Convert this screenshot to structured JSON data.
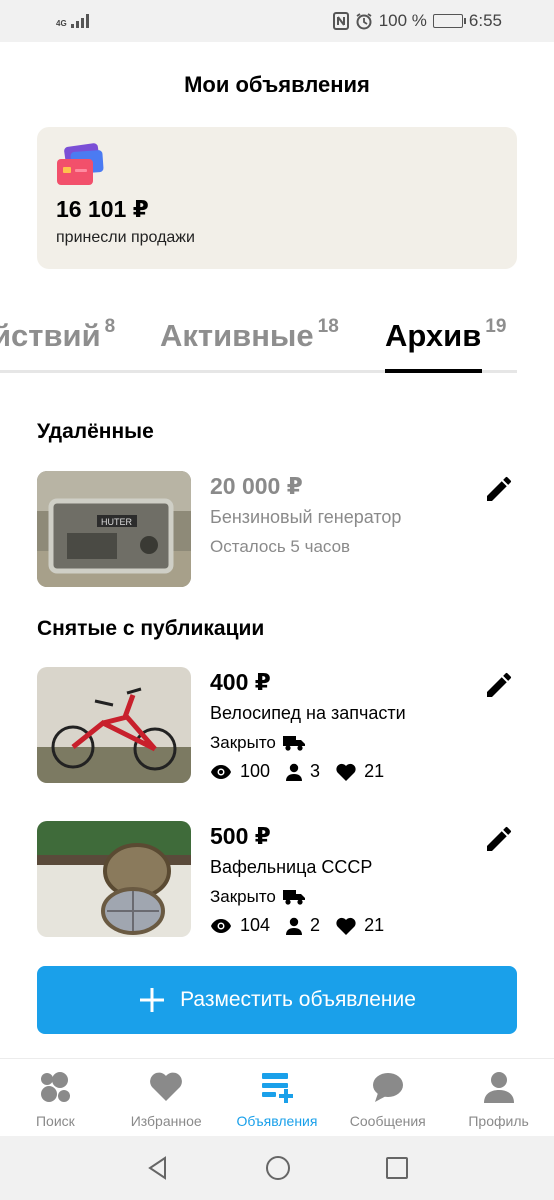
{
  "statusbar": {
    "network": "4G",
    "battery": "100 %",
    "time": "6:55"
  },
  "page_title": "Мои объявления",
  "earnings": {
    "amount": "16 101 ₽",
    "caption": "принесли продажи"
  },
  "tabs": [
    {
      "label": "йствий",
      "count": "8"
    },
    {
      "label": "Активные",
      "count": "18"
    },
    {
      "label": "Архив",
      "count": "19"
    }
  ],
  "sections": {
    "deleted_title": "Удалённые",
    "unpublished_title": "Снятые с публикации"
  },
  "items": [
    {
      "price": "20 000 ₽",
      "title": "Бензиновый генератор",
      "status": "Осталось 5 часов"
    },
    {
      "price": "400 ₽",
      "title": "Велосипед на запчасти",
      "status": "Закрыто",
      "views": "100",
      "contacts": "3",
      "favorites": "21"
    },
    {
      "price": "500 ₽",
      "title": "Вафельница СССР",
      "status": "Закрыто",
      "views": "104",
      "contacts": "2",
      "favorites": "21"
    }
  ],
  "cta_label": "Разместить объявление",
  "nav": [
    {
      "label": "Поиск",
      "icon": "search-bubbles-icon"
    },
    {
      "label": "Избранное",
      "icon": "heart-icon"
    },
    {
      "label": "Объявления",
      "icon": "ads-add-icon"
    },
    {
      "label": "Сообщения",
      "icon": "chat-icon"
    },
    {
      "label": "Профиль",
      "icon": "profile-icon"
    }
  ],
  "colors": {
    "accent": "#1aa0ea",
    "card_bg": "#f2efe8",
    "muted": "#8a8a8a"
  }
}
